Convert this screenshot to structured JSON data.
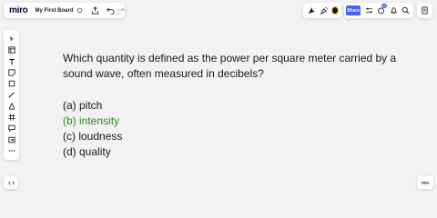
{
  "header": {
    "logo": "miro",
    "board_name": "My First Board"
  },
  "share_label": "Share",
  "notification_count": "12",
  "zoom_level": "70%",
  "question": {
    "text": "Which quantity is defined as the power per square meter carried by a sound wave, often measured in decibels?",
    "options": [
      {
        "label": "(a) pitch",
        "correct": false
      },
      {
        "label": "(b) intensity",
        "correct": true
      },
      {
        "label": "(c) loudness",
        "correct": false
      },
      {
        "label": "(d) quality",
        "correct": false
      }
    ]
  },
  "colors": {
    "accent": "#4262ff",
    "correct_answer": "#2d8a1f"
  },
  "icons": {
    "toolbar": [
      "select-icon",
      "frame-template-icon",
      "text-icon",
      "sticky-note-icon",
      "shape-icon",
      "pen-icon",
      "pen-tool-icon",
      "frame-icon",
      "comment-icon",
      "upload-icon",
      "more-icon"
    ]
  }
}
